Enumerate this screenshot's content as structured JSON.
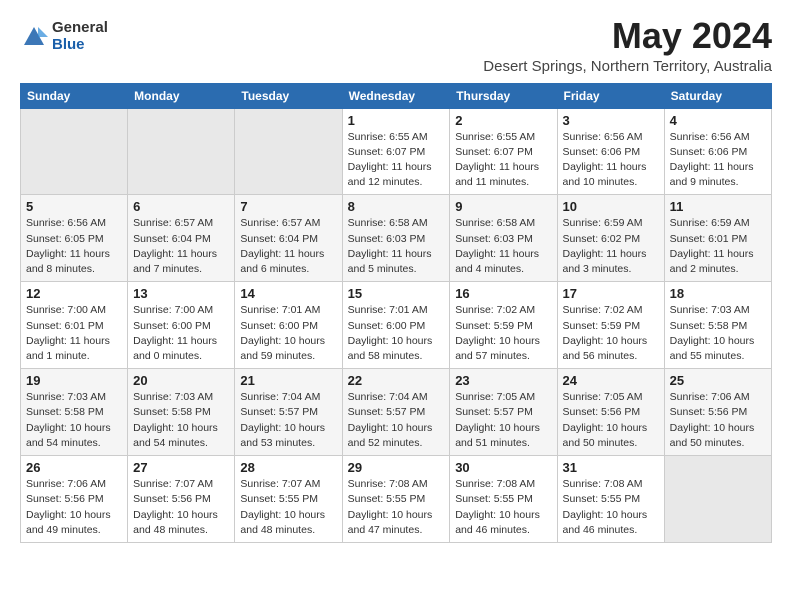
{
  "header": {
    "logo": {
      "general": "General",
      "blue": "Blue"
    },
    "title": "May 2024",
    "subtitle": "Desert Springs, Northern Territory, Australia"
  },
  "weekdays": [
    "Sunday",
    "Monday",
    "Tuesday",
    "Wednesday",
    "Thursday",
    "Friday",
    "Saturday"
  ],
  "weeks": [
    {
      "days": [
        {
          "num": "",
          "info": "",
          "empty": true
        },
        {
          "num": "",
          "info": "",
          "empty": true
        },
        {
          "num": "",
          "info": "",
          "empty": true
        },
        {
          "num": "1",
          "info": "Sunrise: 6:55 AM\nSunset: 6:07 PM\nDaylight: 11 hours\nand 12 minutes."
        },
        {
          "num": "2",
          "info": "Sunrise: 6:55 AM\nSunset: 6:07 PM\nDaylight: 11 hours\nand 11 minutes."
        },
        {
          "num": "3",
          "info": "Sunrise: 6:56 AM\nSunset: 6:06 PM\nDaylight: 11 hours\nand 10 minutes."
        },
        {
          "num": "4",
          "info": "Sunrise: 6:56 AM\nSunset: 6:06 PM\nDaylight: 11 hours\nand 9 minutes."
        }
      ]
    },
    {
      "days": [
        {
          "num": "5",
          "info": "Sunrise: 6:56 AM\nSunset: 6:05 PM\nDaylight: 11 hours\nand 8 minutes."
        },
        {
          "num": "6",
          "info": "Sunrise: 6:57 AM\nSunset: 6:04 PM\nDaylight: 11 hours\nand 7 minutes."
        },
        {
          "num": "7",
          "info": "Sunrise: 6:57 AM\nSunset: 6:04 PM\nDaylight: 11 hours\nand 6 minutes."
        },
        {
          "num": "8",
          "info": "Sunrise: 6:58 AM\nSunset: 6:03 PM\nDaylight: 11 hours\nand 5 minutes."
        },
        {
          "num": "9",
          "info": "Sunrise: 6:58 AM\nSunset: 6:03 PM\nDaylight: 11 hours\nand 4 minutes."
        },
        {
          "num": "10",
          "info": "Sunrise: 6:59 AM\nSunset: 6:02 PM\nDaylight: 11 hours\nand 3 minutes."
        },
        {
          "num": "11",
          "info": "Sunrise: 6:59 AM\nSunset: 6:01 PM\nDaylight: 11 hours\nand 2 minutes."
        }
      ]
    },
    {
      "days": [
        {
          "num": "12",
          "info": "Sunrise: 7:00 AM\nSunset: 6:01 PM\nDaylight: 11 hours\nand 1 minute."
        },
        {
          "num": "13",
          "info": "Sunrise: 7:00 AM\nSunset: 6:00 PM\nDaylight: 11 hours\nand 0 minutes."
        },
        {
          "num": "14",
          "info": "Sunrise: 7:01 AM\nSunset: 6:00 PM\nDaylight: 10 hours\nand 59 minutes."
        },
        {
          "num": "15",
          "info": "Sunrise: 7:01 AM\nSunset: 6:00 PM\nDaylight: 10 hours\nand 58 minutes."
        },
        {
          "num": "16",
          "info": "Sunrise: 7:02 AM\nSunset: 5:59 PM\nDaylight: 10 hours\nand 57 minutes."
        },
        {
          "num": "17",
          "info": "Sunrise: 7:02 AM\nSunset: 5:59 PM\nDaylight: 10 hours\nand 56 minutes."
        },
        {
          "num": "18",
          "info": "Sunrise: 7:03 AM\nSunset: 5:58 PM\nDaylight: 10 hours\nand 55 minutes."
        }
      ]
    },
    {
      "days": [
        {
          "num": "19",
          "info": "Sunrise: 7:03 AM\nSunset: 5:58 PM\nDaylight: 10 hours\nand 54 minutes."
        },
        {
          "num": "20",
          "info": "Sunrise: 7:03 AM\nSunset: 5:58 PM\nDaylight: 10 hours\nand 54 minutes."
        },
        {
          "num": "21",
          "info": "Sunrise: 7:04 AM\nSunset: 5:57 PM\nDaylight: 10 hours\nand 53 minutes."
        },
        {
          "num": "22",
          "info": "Sunrise: 7:04 AM\nSunset: 5:57 PM\nDaylight: 10 hours\nand 52 minutes."
        },
        {
          "num": "23",
          "info": "Sunrise: 7:05 AM\nSunset: 5:57 PM\nDaylight: 10 hours\nand 51 minutes."
        },
        {
          "num": "24",
          "info": "Sunrise: 7:05 AM\nSunset: 5:56 PM\nDaylight: 10 hours\nand 50 minutes."
        },
        {
          "num": "25",
          "info": "Sunrise: 7:06 AM\nSunset: 5:56 PM\nDaylight: 10 hours\nand 50 minutes."
        }
      ]
    },
    {
      "days": [
        {
          "num": "26",
          "info": "Sunrise: 7:06 AM\nSunset: 5:56 PM\nDaylight: 10 hours\nand 49 minutes."
        },
        {
          "num": "27",
          "info": "Sunrise: 7:07 AM\nSunset: 5:56 PM\nDaylight: 10 hours\nand 48 minutes."
        },
        {
          "num": "28",
          "info": "Sunrise: 7:07 AM\nSunset: 5:55 PM\nDaylight: 10 hours\nand 48 minutes."
        },
        {
          "num": "29",
          "info": "Sunrise: 7:08 AM\nSunset: 5:55 PM\nDaylight: 10 hours\nand 47 minutes."
        },
        {
          "num": "30",
          "info": "Sunrise: 7:08 AM\nSunset: 5:55 PM\nDaylight: 10 hours\nand 46 minutes."
        },
        {
          "num": "31",
          "info": "Sunrise: 7:08 AM\nSunset: 5:55 PM\nDaylight: 10 hours\nand 46 minutes."
        },
        {
          "num": "",
          "info": "",
          "empty": true
        }
      ]
    }
  ]
}
